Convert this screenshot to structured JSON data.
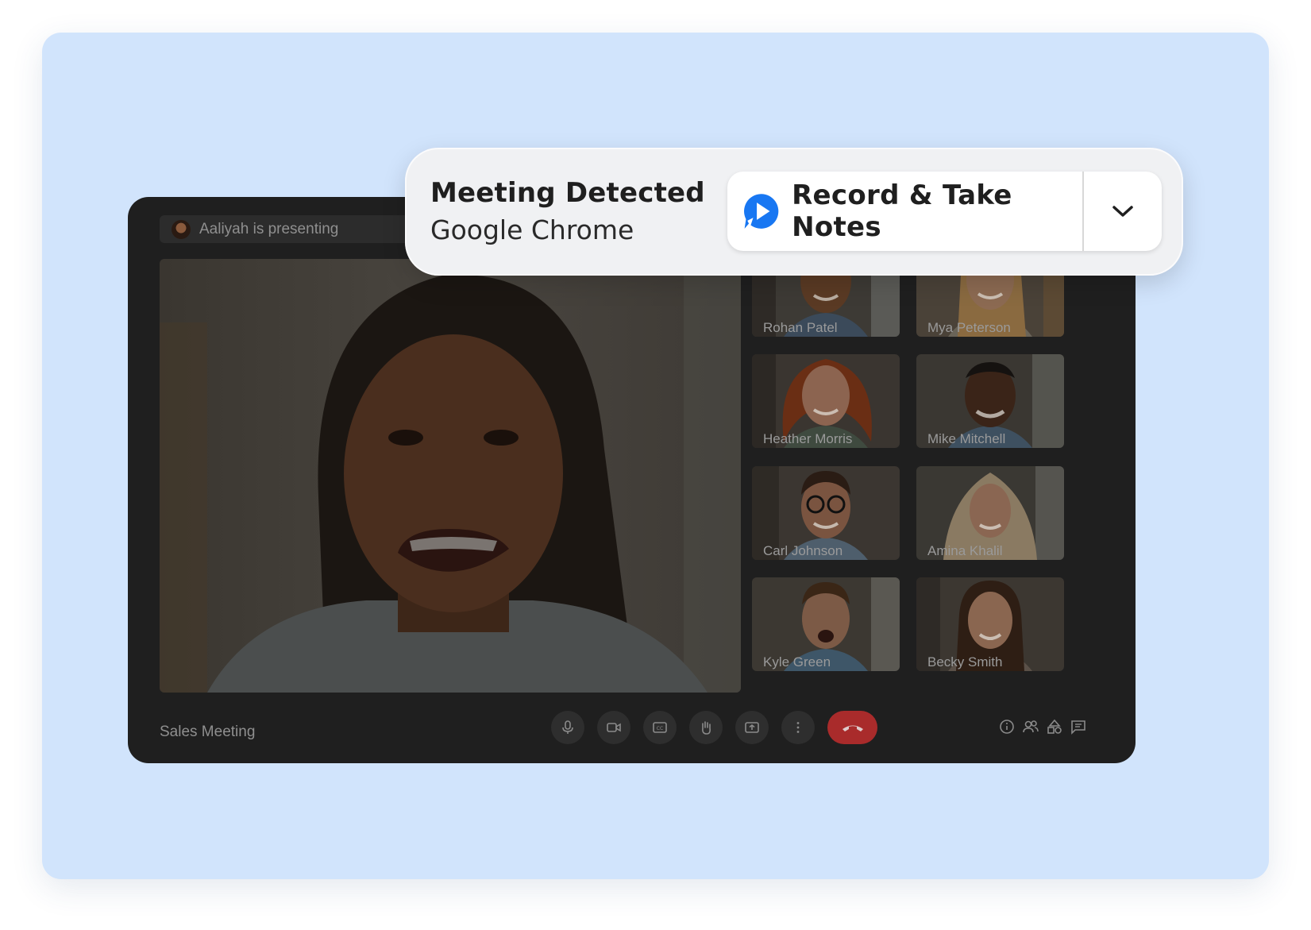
{
  "meeting": {
    "presenter_text": "Aaliyah is presenting",
    "title": "Sales Meeting",
    "participants": [
      {
        "name": "Rohan Patel"
      },
      {
        "name": "Mya Peterson"
      },
      {
        "name": "Heather Morris"
      },
      {
        "name": "Mike Mitchell"
      },
      {
        "name": "Carl Johnson"
      },
      {
        "name": "Amina Khalil"
      },
      {
        "name": "Kyle Green"
      },
      {
        "name": "Becky Smith"
      }
    ],
    "controls": [
      "microphone-icon",
      "camera-icon",
      "captions-icon",
      "raise-hand-icon",
      "present-screen-icon",
      "more-options-icon",
      "end-call-icon"
    ],
    "side_icons": [
      "info-icon",
      "people-icon",
      "activities-icon",
      "chat-icon"
    ]
  },
  "notification": {
    "title": "Meeting Detected",
    "subtitle": "Google Chrome",
    "action_label": "Record & Take Notes",
    "action_icon": "app-logo-icon",
    "dropdown_icon": "chevron-down-icon"
  },
  "colors": {
    "backdrop": "#d1e4fc",
    "window": "#1f1f1f",
    "end_call": "#a92b2b",
    "brand": "#1877f2"
  }
}
